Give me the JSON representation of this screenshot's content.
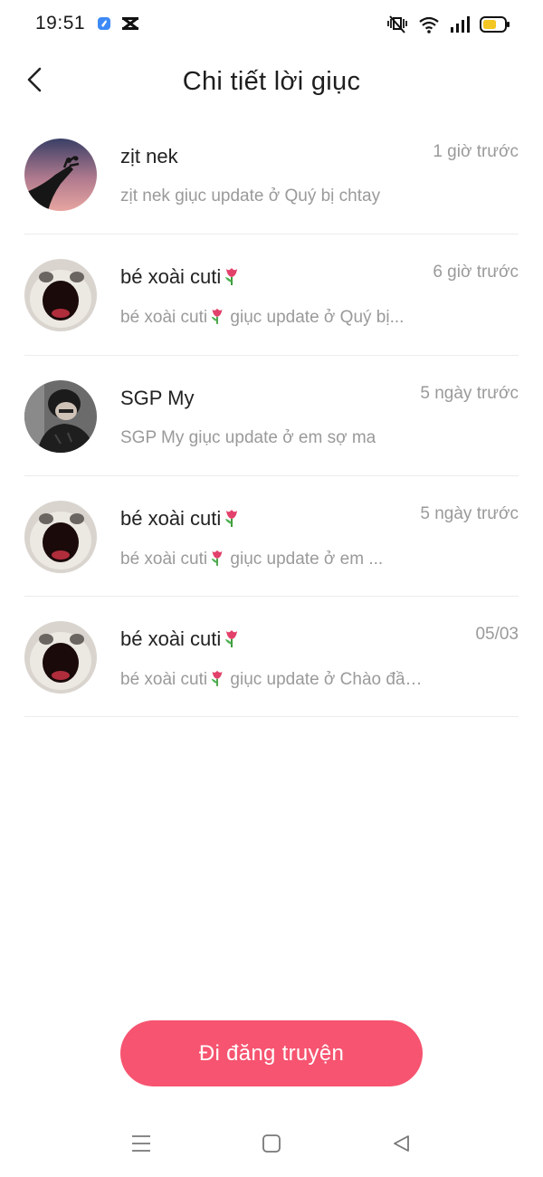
{
  "status_bar": {
    "time": "19:51",
    "icons": [
      "app-notification-icon",
      "capcut-icon",
      "mute-vibrate-icon",
      "wifi-icon",
      "signal-icon",
      "battery-icon"
    ]
  },
  "header": {
    "title": "Chi tiết lời giục",
    "back_icon": "chevron-left-icon"
  },
  "reminders": [
    {
      "name": "zịt nek",
      "tulip": false,
      "time": "1 giờ trước",
      "message": "zịt nek giục update ở Quý bị chtay",
      "message_tulip": false,
      "message_prefix": "zịt nek",
      "message_rest": "giục update ở Quý bị chtay"
    },
    {
      "name": "bé xoài cuti",
      "tulip": true,
      "time": "6 giờ trước",
      "message_prefix": "bé xoài cuti",
      "message_tulip": true,
      "message_rest": "giục update ở Quý bị..."
    },
    {
      "name": "SGP My",
      "tulip": false,
      "time": "5 ngày trước",
      "message_prefix": "SGP My",
      "message_tulip": false,
      "message_rest": "giục update ở em sợ ma"
    },
    {
      "name": "bé xoài cuti",
      "tulip": true,
      "time": "5 ngày trước",
      "message_prefix": "bé xoài cuti",
      "message_tulip": true,
      "message_rest": "giục update ở em ..."
    },
    {
      "name": "bé xoài cuti",
      "tulip": true,
      "time": "05/03",
      "message_prefix": "bé xoài cuti",
      "message_tulip": true,
      "message_rest": "giục update ở Chào đầu ..."
    }
  ],
  "cta": {
    "label": "Đi đăng truyện"
  },
  "nav": {
    "icons": [
      "menu-icon",
      "home-square-icon",
      "back-triangle-icon"
    ]
  },
  "colors": {
    "accent": "#f65470",
    "secondary_text": "#9a9a9a",
    "divider": "#ececec"
  }
}
